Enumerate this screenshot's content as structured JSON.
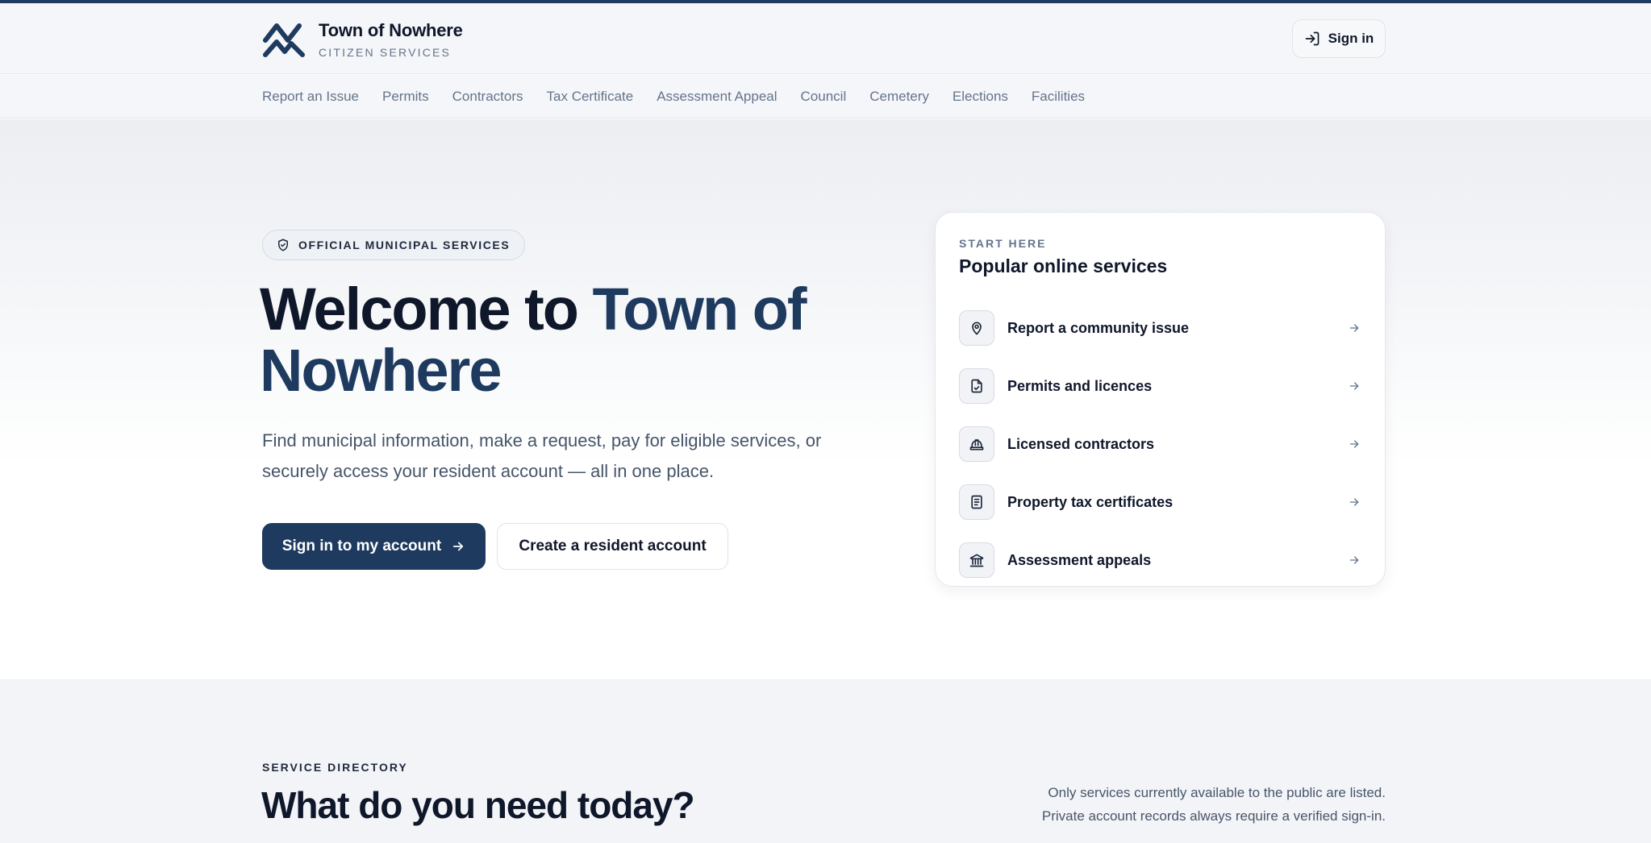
{
  "brand": {
    "name": "Town of Nowhere",
    "subtitle": "CITIZEN SERVICES",
    "logo_icon": "mountain-logo-icon"
  },
  "header": {
    "signin_label": "Sign in",
    "signin_icon": "sign-in-icon"
  },
  "nav": {
    "items": [
      {
        "label": "Report an Issue"
      },
      {
        "label": "Permits"
      },
      {
        "label": "Contractors"
      },
      {
        "label": "Tax Certificate"
      },
      {
        "label": "Assessment Appeal"
      },
      {
        "label": "Council"
      },
      {
        "label": "Cemetery"
      },
      {
        "label": "Elections"
      },
      {
        "label": "Facilities"
      }
    ]
  },
  "hero": {
    "badge": "OFFICIAL MUNICIPAL SERVICES",
    "badge_icon": "shield-check-icon",
    "title_plain": "Welcome to ",
    "title_accent": "Town of Nowhere",
    "description": "Find municipal information, make a request, pay for eligible services, or securely access your resident account — all in one place.",
    "primary_button": "Sign in to my account",
    "secondary_button": "Create a resident account"
  },
  "popular": {
    "eyebrow": "START HERE",
    "title": "Popular online services",
    "items": [
      {
        "label": "Report a community issue",
        "icon": "map-pin-icon"
      },
      {
        "label": "Permits and licences",
        "icon": "file-check-icon"
      },
      {
        "label": "Licensed contractors",
        "icon": "hard-hat-icon"
      },
      {
        "label": "Property tax certificates",
        "icon": "document-icon"
      },
      {
        "label": "Assessment appeals",
        "icon": "landmark-icon"
      }
    ]
  },
  "directory": {
    "eyebrow": "SERVICE DIRECTORY",
    "title": "What do you need today?",
    "note_line1": "Only services currently available to the public are listed.",
    "note_line2": "Private account records always require a verified sign-in."
  },
  "colors": {
    "accent": "#1e3a5f",
    "text": "#0f172a",
    "muted": "#64748b",
    "background": "#f5f6f9"
  }
}
